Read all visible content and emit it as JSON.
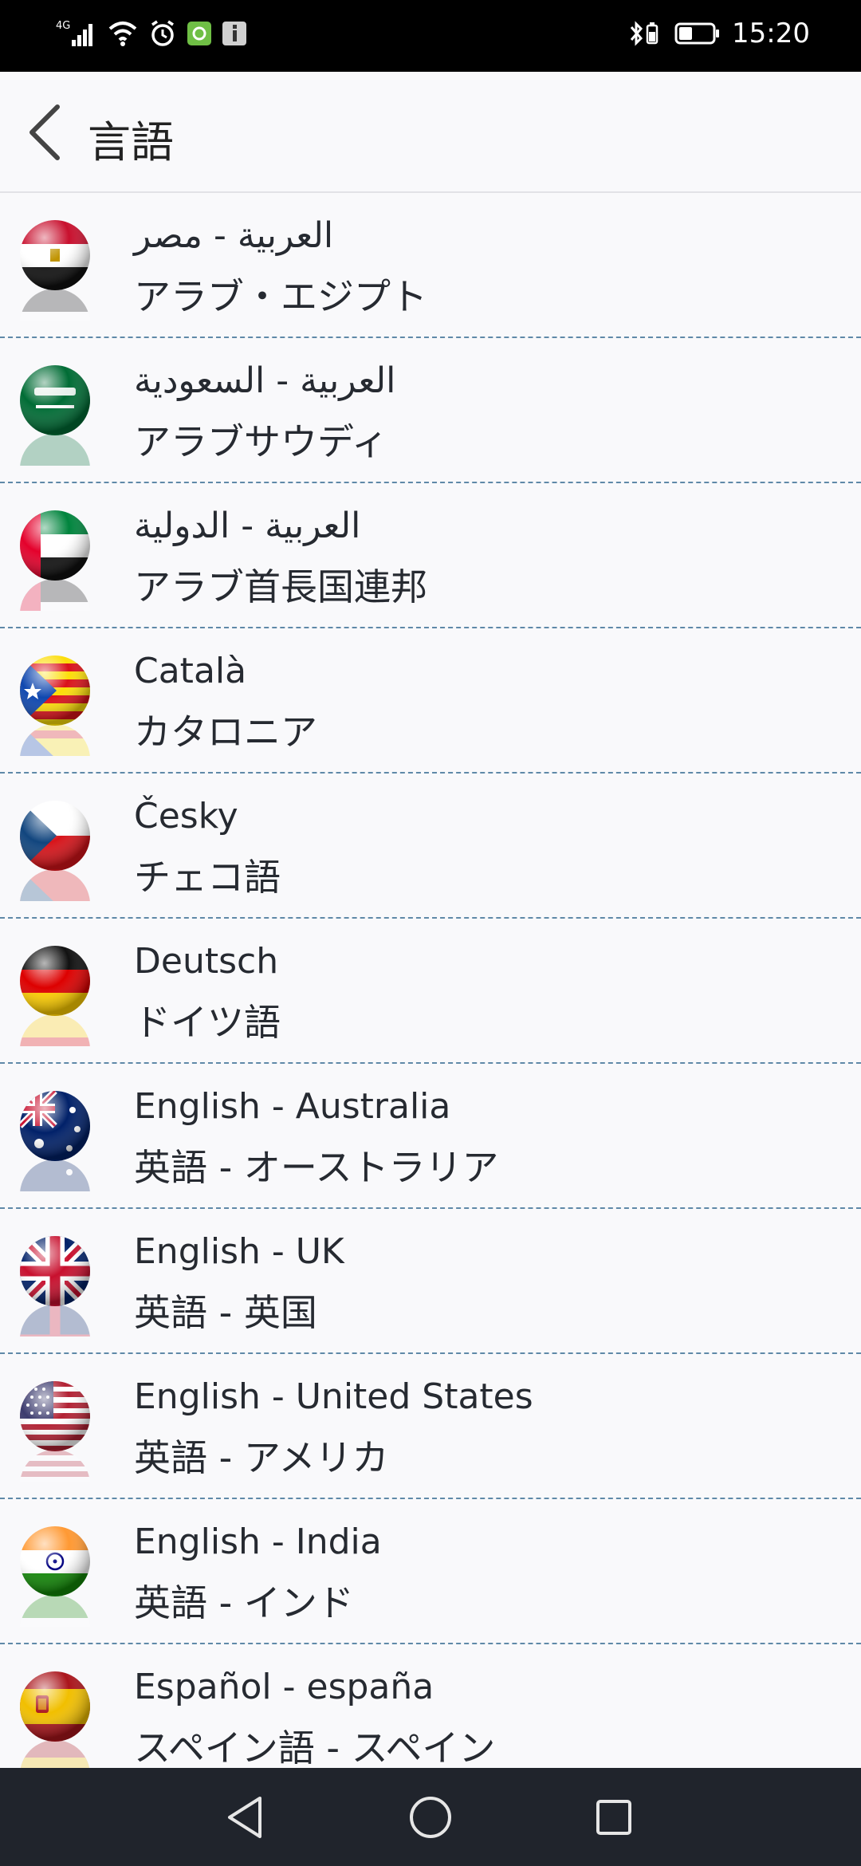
{
  "status_bar": {
    "network": "4G",
    "time": "15:20"
  },
  "header": {
    "title": "言語"
  },
  "languages": [
    {
      "native": "العربية - مصر",
      "translated": "アラブ・エジプト",
      "flag": "egypt-flag-icon",
      "rtl": true
    },
    {
      "native": "العربية - السعودية",
      "translated": "アラブサウディ",
      "flag": "saudi-arabia-flag-icon",
      "rtl": true
    },
    {
      "native": "العربية - الدولية",
      "translated": "アラブ首長国連邦",
      "flag": "uae-flag-icon",
      "rtl": true
    },
    {
      "native": "Català",
      "translated": "カタロニア",
      "flag": "catalonia-flag-icon",
      "rtl": false
    },
    {
      "native": "Česky",
      "translated": "チェコ語",
      "flag": "czech-flag-icon",
      "rtl": false
    },
    {
      "native": "Deutsch",
      "translated": "ドイツ語",
      "flag": "germany-flag-icon",
      "rtl": false
    },
    {
      "native": "English - Australia",
      "translated": "英語 - オーストラリア",
      "flag": "australia-flag-icon",
      "rtl": false
    },
    {
      "native": "English - UK",
      "translated": "英語 - 英国",
      "flag": "uk-flag-icon",
      "rtl": false
    },
    {
      "native": "English - United States",
      "translated": "英語 - アメリカ",
      "flag": "usa-flag-icon",
      "rtl": false
    },
    {
      "native": "English - India",
      "translated": "英語 - インド",
      "flag": "india-flag-icon",
      "rtl": false
    },
    {
      "native": "Español - españa",
      "translated": "スペイン語 - スペイン",
      "flag": "spain-flag-icon",
      "rtl": false
    }
  ],
  "colors": {
    "status_bar_bg": "#000000",
    "page_bg": "#f9f9fb",
    "divider": "#5f89a8",
    "navbar_bg": "#20242c",
    "text": "#262a31"
  }
}
